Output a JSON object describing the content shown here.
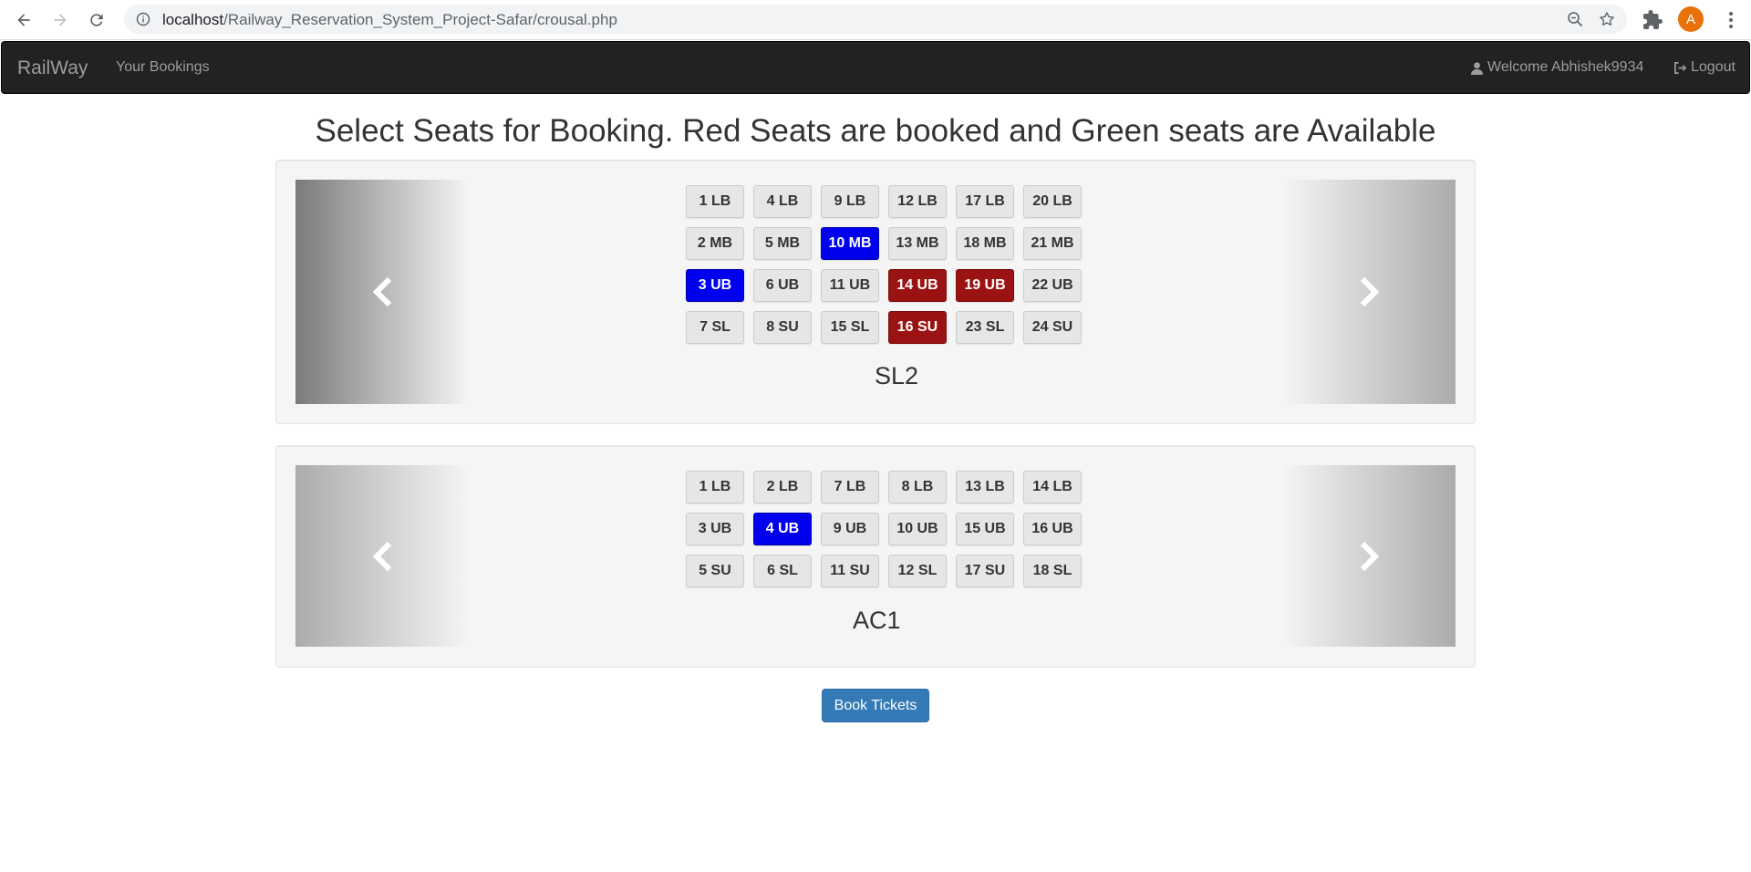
{
  "browser": {
    "url_host": "localhost",
    "url_path": "/Railway_Reservation_System_Project-Safar/crousal.php",
    "avatar_letter": "A"
  },
  "navbar": {
    "brand": "RailWay",
    "your_bookings": "Your Bookings",
    "welcome": "Welcome Abhishek9934",
    "logout": "Logout"
  },
  "heading": "Select Seats for Booking. Red Seats are booked and Green seats are Available",
  "colors": {
    "booked": "#9b1212",
    "selected": "#0000ee",
    "available": "#e6e6e6",
    "primary_button": "#337ab7",
    "navbar": "#222222"
  },
  "coaches": [
    {
      "name": "SL2",
      "seats": [
        {
          "label": "1 LB",
          "state": "available"
        },
        {
          "label": "4 LB",
          "state": "available"
        },
        {
          "label": "9 LB",
          "state": "available"
        },
        {
          "label": "12 LB",
          "state": "available"
        },
        {
          "label": "17 LB",
          "state": "available"
        },
        {
          "label": "20 LB",
          "state": "available"
        },
        {
          "label": "2 MB",
          "state": "available"
        },
        {
          "label": "5 MB",
          "state": "available"
        },
        {
          "label": "10 MB",
          "state": "selected"
        },
        {
          "label": "13 MB",
          "state": "available"
        },
        {
          "label": "18 MB",
          "state": "available"
        },
        {
          "label": "21 MB",
          "state": "available"
        },
        {
          "label": "3 UB",
          "state": "selected"
        },
        {
          "label": "6 UB",
          "state": "available"
        },
        {
          "label": "11 UB",
          "state": "available"
        },
        {
          "label": "14 UB",
          "state": "booked"
        },
        {
          "label": "19 UB",
          "state": "booked"
        },
        {
          "label": "22 UB",
          "state": "available"
        },
        {
          "label": "7 SL",
          "state": "available"
        },
        {
          "label": "8 SU",
          "state": "available"
        },
        {
          "label": "15 SL",
          "state": "available"
        },
        {
          "label": "16 SU",
          "state": "booked"
        },
        {
          "label": "23 SL",
          "state": "available"
        },
        {
          "label": "24 SU",
          "state": "available"
        }
      ]
    },
    {
      "name": "AC1",
      "seats": [
        {
          "label": "1 LB",
          "state": "available"
        },
        {
          "label": "2 LB",
          "state": "available"
        },
        {
          "label": "7 LB",
          "state": "available"
        },
        {
          "label": "8 LB",
          "state": "available"
        },
        {
          "label": "13 LB",
          "state": "available"
        },
        {
          "label": "14 LB",
          "state": "available"
        },
        {
          "label": "3 UB",
          "state": "available"
        },
        {
          "label": "4 UB",
          "state": "selected"
        },
        {
          "label": "9 UB",
          "state": "available"
        },
        {
          "label": "10 UB",
          "state": "available"
        },
        {
          "label": "15 UB",
          "state": "available"
        },
        {
          "label": "16 UB",
          "state": "available"
        },
        {
          "label": "5 SU",
          "state": "available"
        },
        {
          "label": "6 SL",
          "state": "available"
        },
        {
          "label": "11 SU",
          "state": "available"
        },
        {
          "label": "12 SL",
          "state": "available"
        },
        {
          "label": "17 SU",
          "state": "available"
        },
        {
          "label": "18 SL",
          "state": "available"
        }
      ]
    }
  ],
  "book_button": "Book Tickets"
}
